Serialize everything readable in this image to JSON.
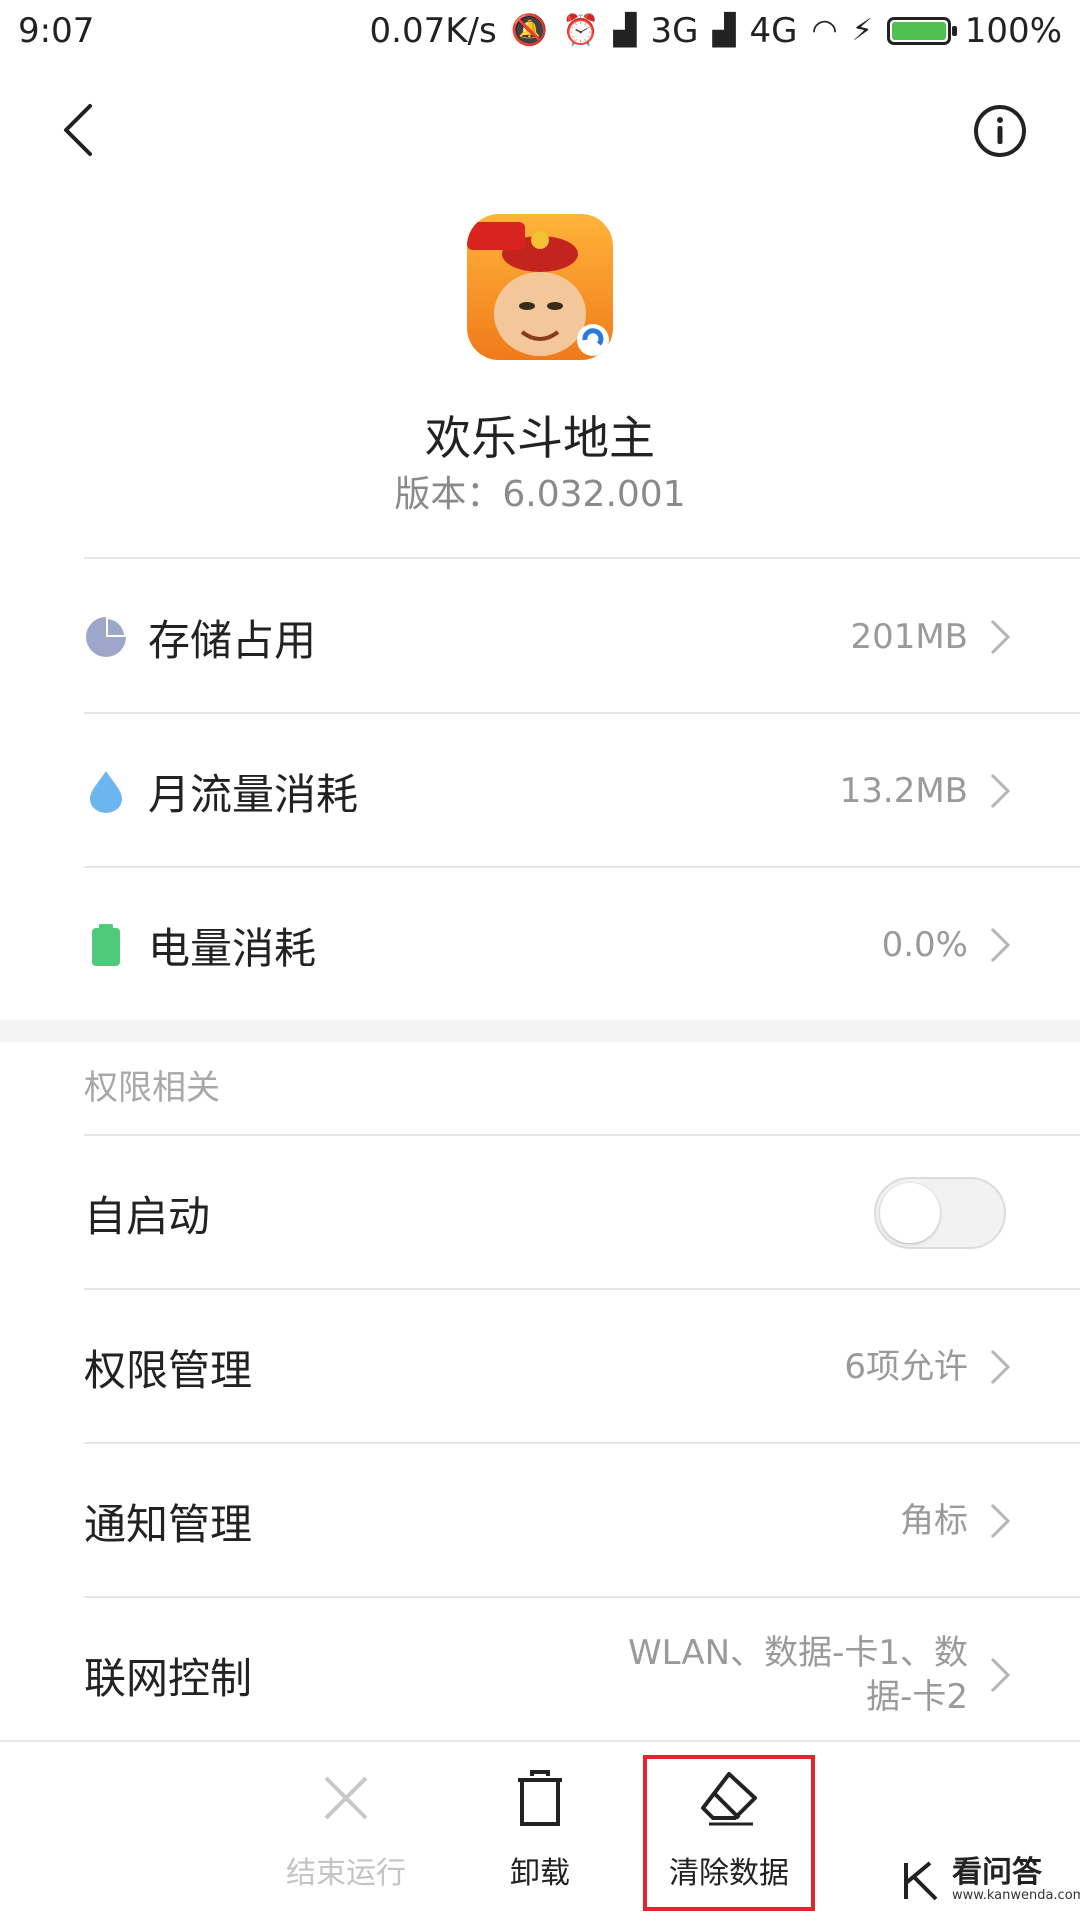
{
  "status_bar": {
    "time": "9:07",
    "net_speed": "0.07K/s",
    "sim1": "3G",
    "sim2": "4G",
    "battery": "100%"
  },
  "header": {
    "app_name": "欢乐斗地主",
    "version": "版本：6.032.001"
  },
  "usage": [
    {
      "label": "存储占用",
      "value": "201MB",
      "icon": "storage-pie-icon"
    },
    {
      "label": "月流量消耗",
      "value": "13.2MB",
      "icon": "water-drop-icon"
    },
    {
      "label": "电量消耗",
      "value": "0.0%",
      "icon": "battery-icon"
    }
  ],
  "permissions": {
    "section_title": "权限相关",
    "autostart_label": "自启动",
    "autostart_on": false,
    "items": [
      {
        "label": "权限管理",
        "value": "6项允许"
      },
      {
        "label": "通知管理",
        "value": "角标"
      },
      {
        "label": "联网控制",
        "value_line1": "WLAN、数据-卡1、数",
        "value_line2": "据-卡2"
      }
    ]
  },
  "actions": {
    "force_stop": "结束运行",
    "uninstall": "卸载",
    "clear_data": "清除数据"
  },
  "watermark": {
    "text": "看问答",
    "url": "www.kanwenda.com"
  },
  "colors": {
    "highlight": "#e0262b",
    "storage_icon": "#9ea7c9",
    "drop_icon": "#6bb6f0",
    "battery_icon": "#4fc97a"
  }
}
